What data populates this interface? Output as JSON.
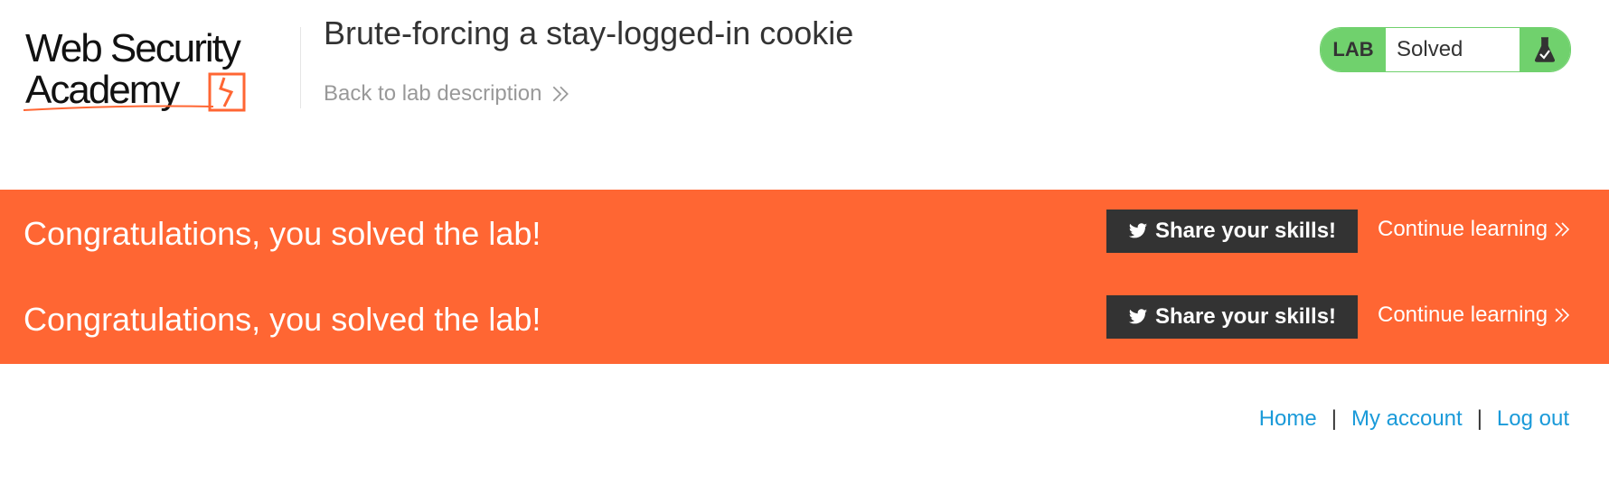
{
  "header": {
    "logo_line1": "Web Security",
    "logo_line2": "Academy",
    "lab_title": "Brute-forcing a stay-logged-in cookie",
    "back_link": "Back to lab description",
    "lab_status": {
      "label": "LAB",
      "text": "Solved",
      "icon": "flask-check-icon"
    }
  },
  "banner": {
    "rows": [
      {
        "message": "Congratulations, you solved the lab!",
        "share_label": "Share your skills!",
        "continue_label": "Continue learning"
      },
      {
        "message": "Congratulations, you solved the lab!",
        "share_label": "Share your skills!",
        "continue_label": "Continue learning"
      }
    ]
  },
  "nav": {
    "home": "Home",
    "separator": "|",
    "my_account": "My account",
    "log_out": "Log out"
  },
  "colors": {
    "brand_orange": "#ff6633",
    "solved_green": "#70d16d",
    "link_blue": "#1a9ad9",
    "dark_button": "#333333"
  }
}
